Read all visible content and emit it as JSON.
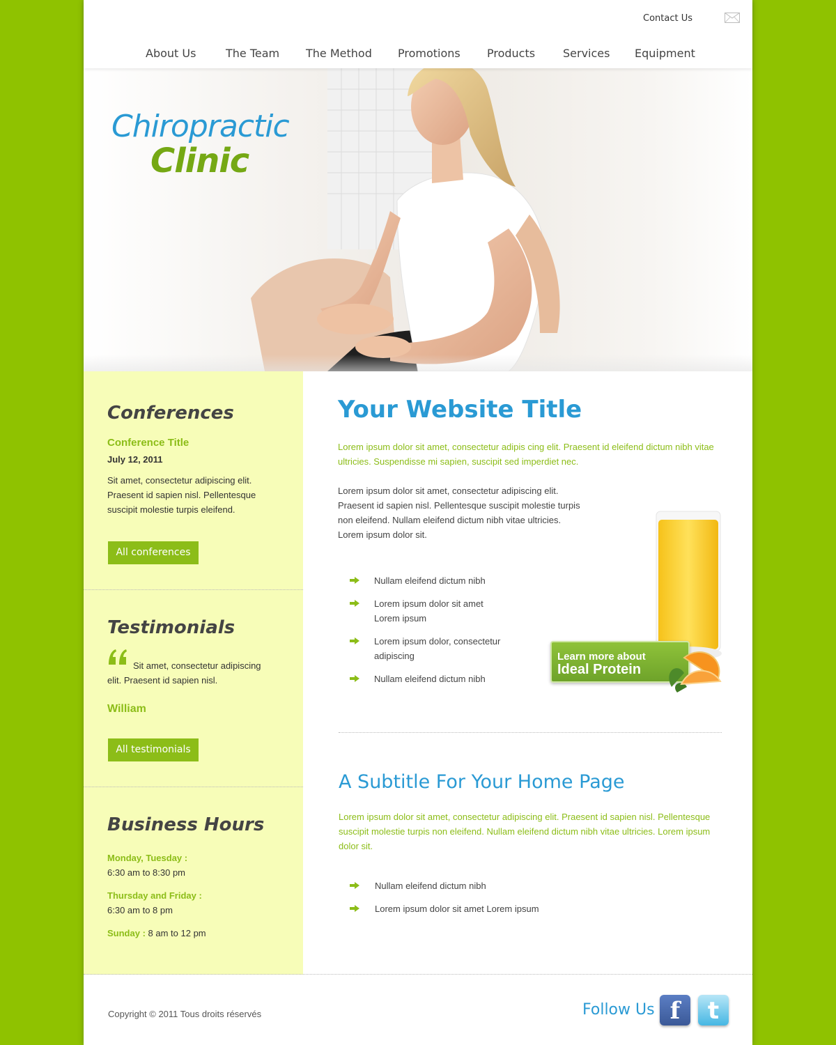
{
  "header": {
    "contact_label": "Contact Us",
    "contact_icon": "mail-icon",
    "nav": [
      "About Us",
      "The Team",
      "The Method",
      "Promotions",
      "Products",
      "Services",
      "Equipment"
    ]
  },
  "hero": {
    "brand_line1": "Chiropractic",
    "brand_line2": "Clinic"
  },
  "sidebar": {
    "conferences": {
      "heading": "Conferences",
      "title": "Conference Title",
      "date": "July 12, 2011",
      "text": "Sit amet, consectetur adipiscing elit. Praesent id sapien nisl. Pellentesque suscipit molestie turpis eleifend.",
      "button": "All conferences"
    },
    "testimonials": {
      "heading": "Testimonials",
      "quote": "Sit amet, consectetur adipiscing elit. Praesent id sapien nisl.",
      "author": "William",
      "button": "All testimonials"
    },
    "hours": {
      "heading": "Business Hours",
      "row1_label": "Monday, Tuesday :",
      "row1_value": "6:30 am to 8:30 pm",
      "row2_label": "Thursday and Friday :",
      "row2_value": "6:30 am to 8 pm",
      "row3_label": "Sunday :",
      "row3_value": "8 am to 12 pm"
    }
  },
  "main": {
    "title": "Your Website Title",
    "lead": "Lorem ipsum dolor sit amet, consectetur adipis cing elit. Praesent id eleifend dictum nibh vitae ultricies. Suspendisse mi sapien, suscipit sed imperdiet nec.",
    "body": "Lorem ipsum dolor sit amet, consectetur adipiscing elit. Praesent id sapien nisl. Pellentesque suscipit molestie turpis non eleifend. Nullam eleifend dictum nibh vitae ultricies. Lorem ipsum dolor sit.",
    "bullets": [
      "Nullam eleifend dictum nibh",
      "Lorem ipsum dolor sit amet Lorem ipsum",
      "Lorem ipsum dolor, consectetur adipiscing",
      "Nullam eleifend dictum nibh"
    ],
    "promo_line1": "Learn more about",
    "promo_line2": "Ideal Protein",
    "subtitle": "A Subtitle For Your Home Page",
    "sub_lead": "Lorem ipsum dolor sit amet, consectetur adipiscing elit. Praesent id sapien nisl. Pellentesque suscipit molestie turpis non eleifend. Nullam eleifend dictum nibh vitae ultricies. Lorem ipsum dolor sit.",
    "sub_bullets": [
      "Nullam eleifend dictum nibh",
      "Lorem ipsum dolor sit amet Lorem ipsum"
    ]
  },
  "footer": {
    "copyright": "Copyright © 2011 Tous droits réservés",
    "follow": "Follow Us",
    "facebook_icon": "facebook-icon",
    "twitter_icon": "twitter-icon"
  },
  "colors": {
    "background": "#8fc200",
    "accent_blue": "#2a9ad4",
    "accent_green": "#8cbd18",
    "sidebar": "#f7fdb8"
  }
}
